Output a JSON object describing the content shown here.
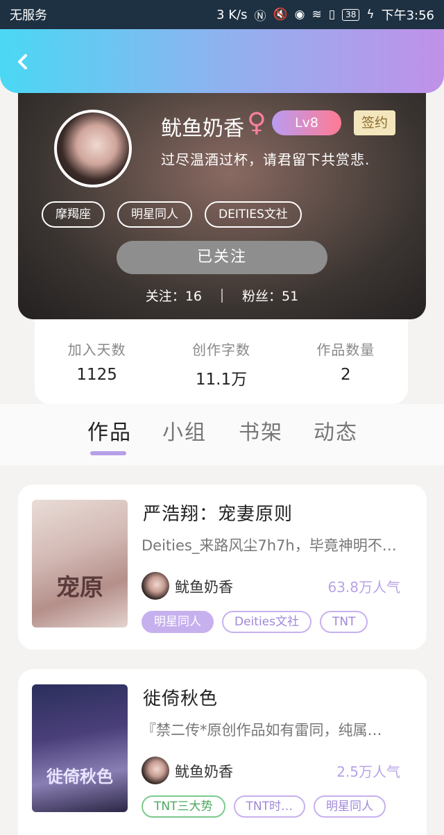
{
  "status_bar": {
    "carrier": "无服务",
    "speed": "3 K/s",
    "battery": "38",
    "time": "下午3:56",
    "icons": [
      "nfc-icon",
      "mute-icon",
      "eye-icon",
      "wifi-icon",
      "sim-alert-icon",
      "battery-icon",
      "charging-icon"
    ]
  },
  "header": {
    "back_icon": "chevron-left-icon"
  },
  "profile": {
    "nickname": "鱿鱼奶香",
    "gender_icon": "female-icon",
    "gender_symbol": "♀",
    "level": "Lv8",
    "sign_badge": "签约",
    "bio": "过尽温酒过杯，请君留下共赏悲.",
    "tags": [
      "摩羯座",
      "明星同人",
      "DEITIES文社"
    ],
    "follow_label": "已关注",
    "following_label": "关注：",
    "following_count": "16",
    "fans_label": "粉丝：",
    "fans_count": "51"
  },
  "info": {
    "days_label": "加入天数",
    "days_value": "1125",
    "words_label": "创作字数",
    "words_value": "11.1万",
    "works_label": "作品数量",
    "works_value": "2"
  },
  "tabs": [
    "作品",
    "小组",
    "书架",
    "动态"
  ],
  "books": [
    {
      "title": "严浩翔：宠妻原则",
      "desc": "Deities_来路风尘7h7h，毕竟神明不…",
      "cover_text": "宠原",
      "author": "鱿鱼奶香",
      "popularity": "63.8万人气",
      "tags": [
        "明星同人",
        "Deities文社",
        "TNT"
      ]
    },
    {
      "title": "徙倚秋色",
      "desc": "『禁二传*原创作品如有雷同，纯属…",
      "cover_text": "徙倚秋色",
      "author": "鱿鱼奶香",
      "popularity": "2.5万人气",
      "tags": [
        "TNT三大势",
        "TNT时…",
        "明星同人"
      ]
    }
  ],
  "colors": {
    "header_gradient_start": "#4ad8f4",
    "header_gradient_end": "#c091e8",
    "accent_purple": "#b79fe8",
    "level_badge_pink": "#ff7b93",
    "tag_green": "#4ea75f"
  }
}
